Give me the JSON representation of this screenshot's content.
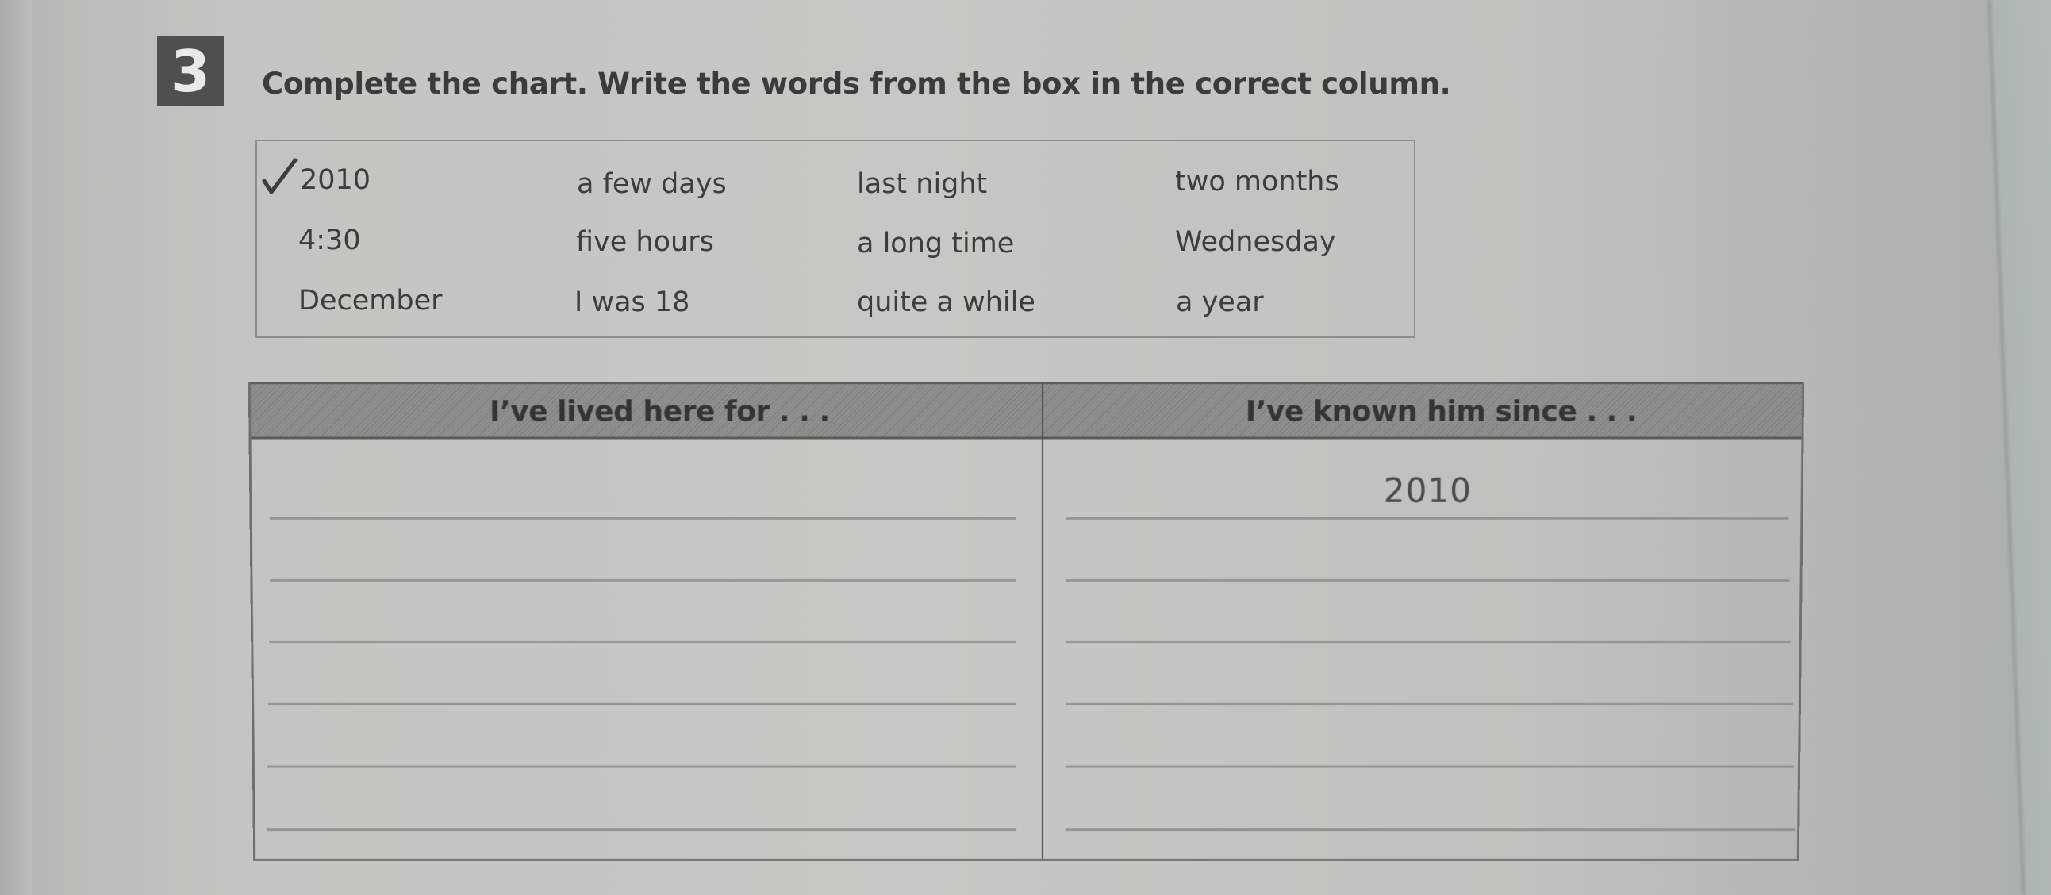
{
  "exercise": {
    "number": "3",
    "instruction": "Complete the chart. Write the words from the box in the correct column."
  },
  "word_box": {
    "rows": [
      [
        {
          "text": "2010",
          "checked": true
        },
        {
          "text": "a few days",
          "checked": false
        },
        {
          "text": "last night",
          "checked": false
        },
        {
          "text": "two months",
          "checked": false
        }
      ],
      [
        {
          "text": "4:30",
          "checked": false
        },
        {
          "text": "five hours",
          "checked": false
        },
        {
          "text": "a long time",
          "checked": false
        },
        {
          "text": "Wednesday",
          "checked": false
        }
      ],
      [
        {
          "text": "December",
          "checked": false
        },
        {
          "text": "I was 18",
          "checked": false
        },
        {
          "text": "quite a while",
          "checked": false
        },
        {
          "text": "a year",
          "checked": false
        }
      ]
    ],
    "check_icon": "checkmark-icon"
  },
  "chart": {
    "columns": [
      {
        "heading": "I’ve lived here for . . .",
        "answers": [
          "",
          "",
          "",
          "",
          "",
          ""
        ]
      },
      {
        "heading": "I’ve known him since . . .",
        "answers": [
          "2010",
          "",
          "",
          "",
          "",
          ""
        ]
      }
    ]
  },
  "colors": {
    "header_fill": "#8e908c",
    "badge_fill": "#4e504d",
    "page": "#c6c8c3"
  }
}
